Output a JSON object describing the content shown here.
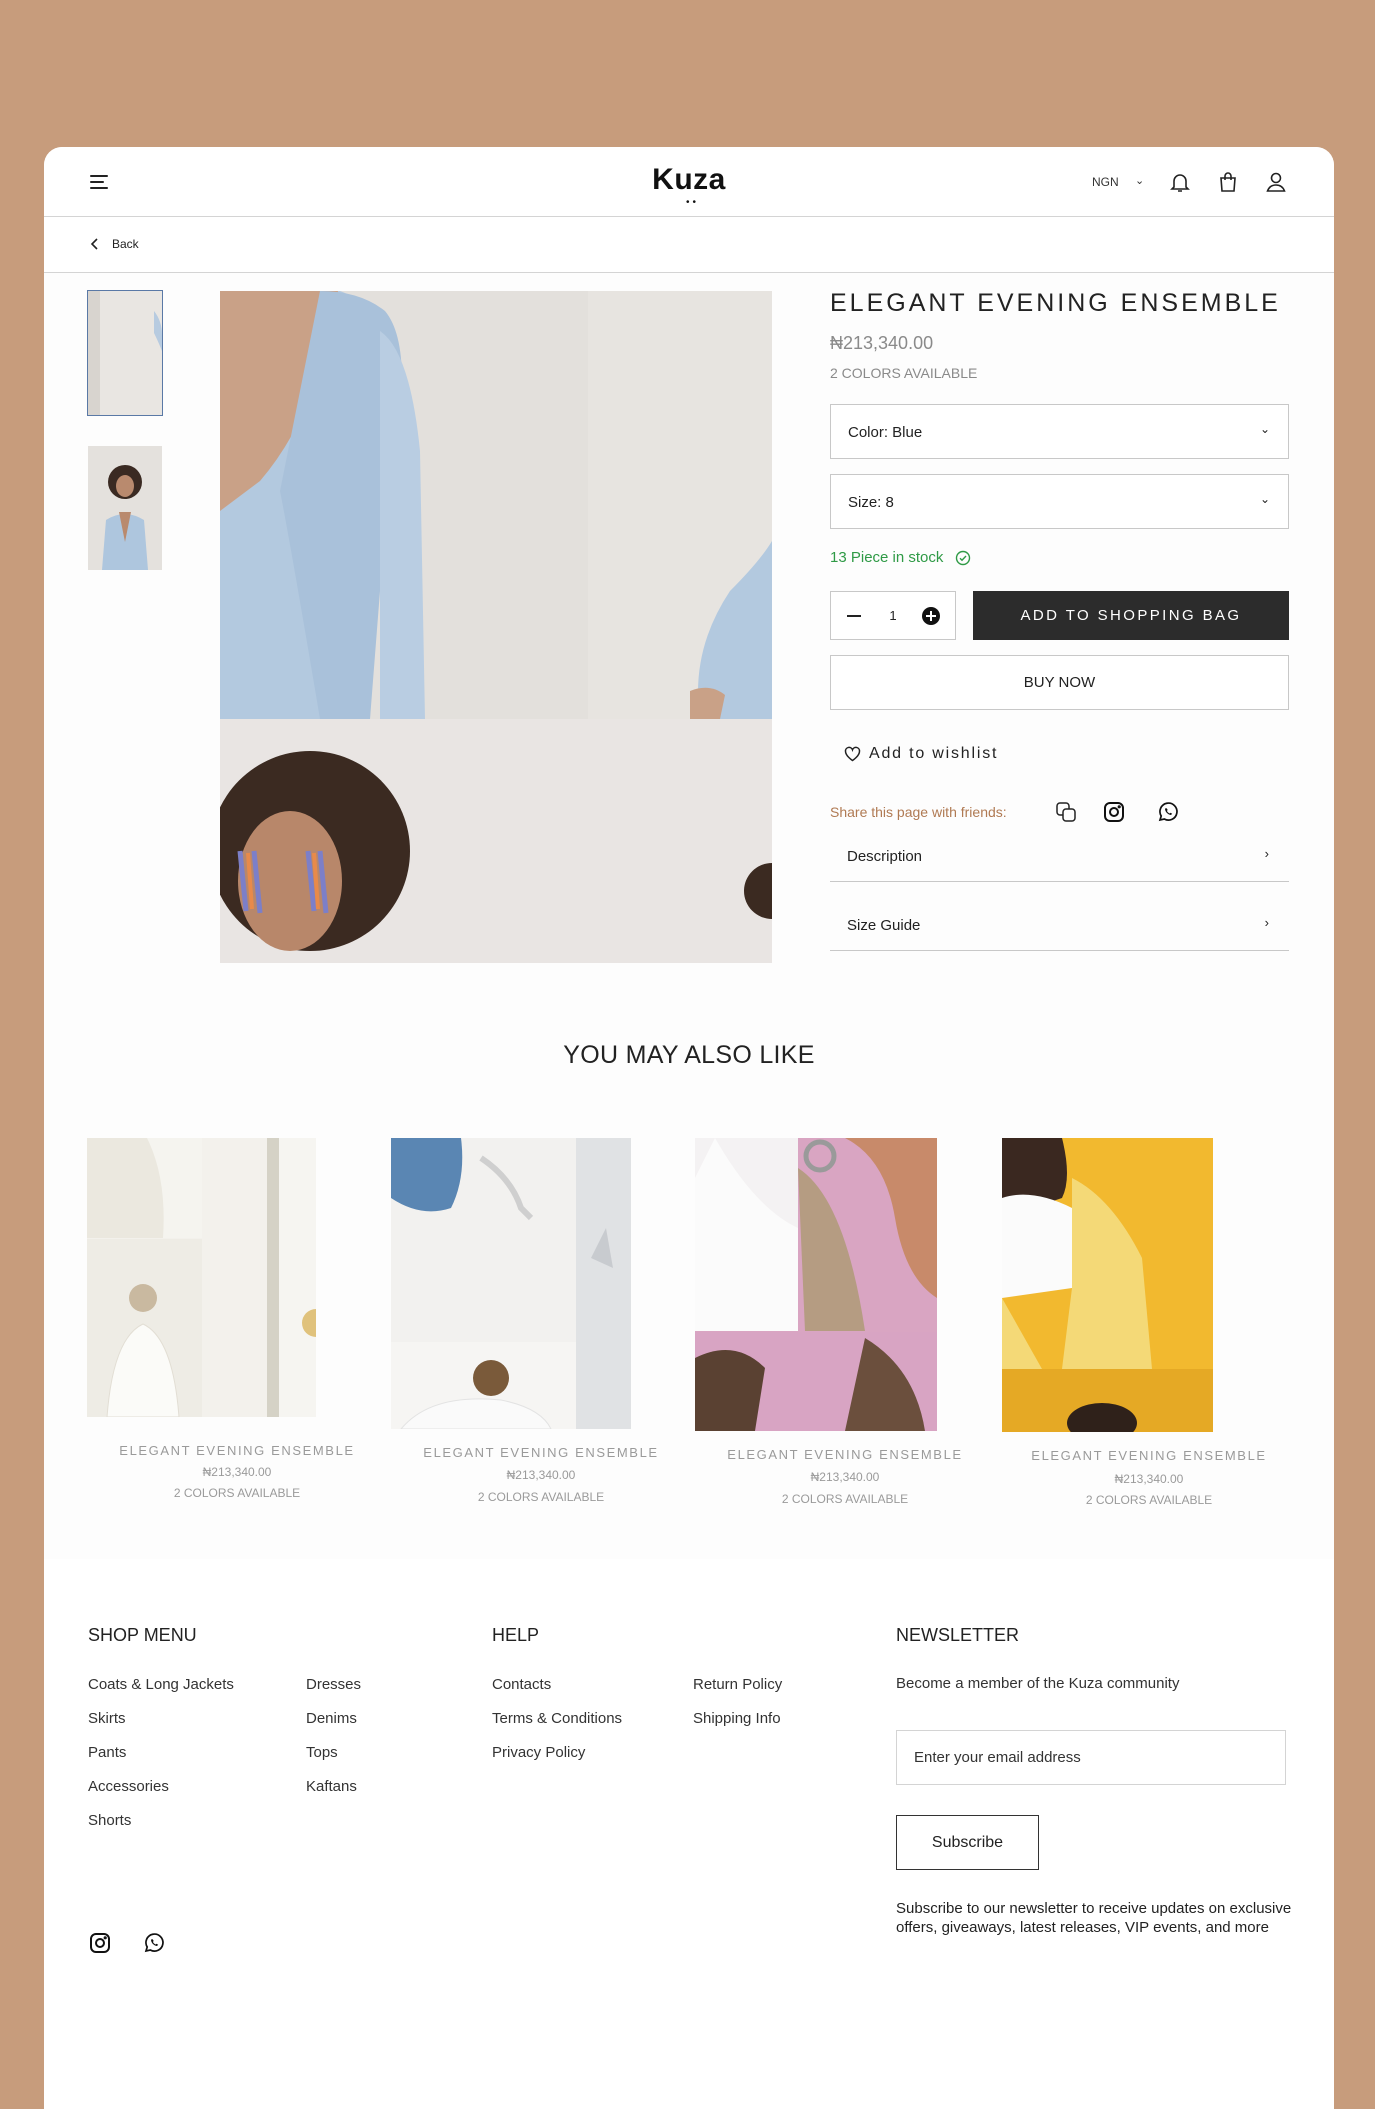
{
  "header": {
    "logo": "Kuza",
    "currency": "NGN",
    "icons": [
      "menu-icon",
      "bell-icon",
      "shopping-bag-icon",
      "user-icon"
    ]
  },
  "nav": {
    "back_label": "Back"
  },
  "product": {
    "title": "ELEGANT EVENING ENSEMBLE",
    "price": "₦213,340.00",
    "colors_available": "2 COLORS AVAILABLE",
    "color_select": "Color: Blue",
    "size_select": "Size: 8",
    "stock_text": "13 Piece in stock",
    "quantity": "1",
    "add_to_bag": "ADD TO SHOPPING BAG",
    "buy_now": "BUY NOW",
    "wishlist": "Add to wishlist",
    "share_text": "Share this page with friends:",
    "accordions": [
      "Description",
      "Size Guide"
    ]
  },
  "recommendations": {
    "heading": "YOU MAY ALSO LIKE",
    "items": [
      {
        "name": "ELEGANT EVENING ENSEMBLE",
        "price": "₦213,340.00",
        "colors": "2 COLORS AVAILABLE"
      },
      {
        "name": "ELEGANT EVENING ENSEMBLE",
        "price": "₦213,340.00",
        "colors": "2 COLORS AVAILABLE"
      },
      {
        "name": "ELEGANT EVENING ENSEMBLE",
        "price": "₦213,340.00",
        "colors": "2 COLORS AVAILABLE"
      },
      {
        "name": "ELEGANT EVENING ENSEMBLE",
        "price": "₦213,340.00",
        "colors": "2 COLORS AVAILABLE"
      }
    ]
  },
  "footer": {
    "shop_menu": {
      "heading": "SHOP MENU",
      "col1": [
        "Coats & Long Jackets",
        "Skirts",
        "Pants",
        "Accessories",
        "Shorts"
      ],
      "col2": [
        "Dresses",
        "Denims",
        "Tops",
        "Kaftans"
      ]
    },
    "help": {
      "heading": "HELP",
      "col1": [
        "Contacts",
        "Terms & Conditions",
        "Privacy Policy"
      ],
      "col2": [
        "Return Policy",
        "Shipping Info"
      ]
    },
    "newsletter": {
      "heading": "NEWSLETTER",
      "tagline": "Become a member of the Kuza community",
      "email_placeholder": "Enter your email address",
      "subscribe_label": "Subscribe",
      "note": "Subscribe to our newsletter to receive updates on exclusive offers, giveaways, latest releases, VIP events, and more"
    }
  },
  "colors": {
    "background": "#c79c7c",
    "accent_dark": "#2c2c2c",
    "stock_green": "#2f9a46",
    "share_brown": "#b07a53"
  }
}
